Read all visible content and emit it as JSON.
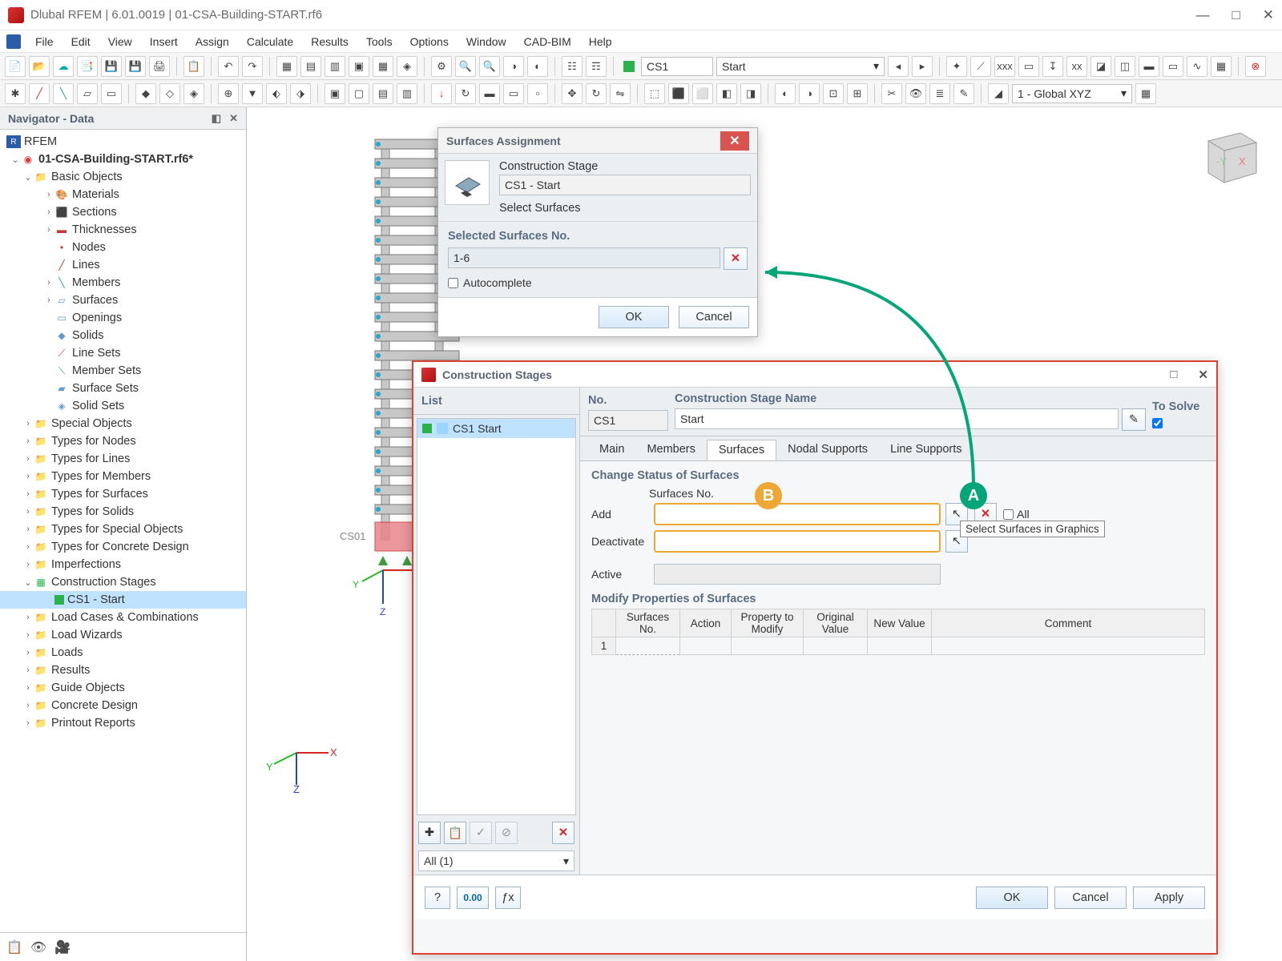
{
  "titlebar": {
    "title": "Dlubal RFEM | 6.01.0019 | 01-CSA-Building-START.rf6"
  },
  "menubar": [
    "File",
    "Edit",
    "View",
    "Insert",
    "Assign",
    "Calculate",
    "Results",
    "Tools",
    "Options",
    "Window",
    "CAD-BIM",
    "Help"
  ],
  "toolbar": {
    "combo_cs": "CS1",
    "combo_stage": "Start",
    "combo_right": "1 - Global XYZ"
  },
  "navigator": {
    "title": "Navigator - Data",
    "root": "RFEM",
    "project": "01-CSA-Building-START.rf6*",
    "basic": "Basic Objects",
    "basic_items": [
      "Materials",
      "Sections",
      "Thicknesses",
      "Nodes",
      "Lines",
      "Members",
      "Surfaces",
      "Openings",
      "Solids",
      "Line Sets",
      "Member Sets",
      "Surface Sets",
      "Solid Sets"
    ],
    "groups": [
      "Special Objects",
      "Types for Nodes",
      "Types for Lines",
      "Types for Members",
      "Types for Surfaces",
      "Types for Solids",
      "Types for Special Objects",
      "Types for Concrete Design",
      "Imperfections"
    ],
    "cs_group": "Construction Stages",
    "cs_child": "CS1 - Start",
    "groups2": [
      "Load Cases & Combinations",
      "Load Wizards",
      "Loads",
      "Results",
      "Guide Objects",
      "Concrete Design",
      "Printout Reports"
    ]
  },
  "canvas": {
    "cs_label": "CS01"
  },
  "surfaces_dialog": {
    "title": "Surfaces Assignment",
    "cs_label": "Construction Stage",
    "cs_value": "CS1 - Start",
    "select_label": "Select Surfaces",
    "selected_label": "Selected Surfaces No.",
    "selected_value": "1-6",
    "autocomplete": "Autocomplete",
    "ok": "OK",
    "cancel": "Cancel"
  },
  "cs_dialog": {
    "title": "Construction Stages",
    "list_label": "List",
    "list_item": "CS1  Start",
    "list_filter": "All (1)",
    "no_label": "No.",
    "no_value": "CS1",
    "name_label": "Construction Stage Name",
    "name_value": "Start",
    "solve_label": "To Solve",
    "tabs": [
      "Main",
      "Members",
      "Surfaces",
      "Nodal Supports",
      "Line Supports"
    ],
    "active_tab": 2,
    "change_status": "Change Status of Surfaces",
    "surfaces_no": "Surfaces No.",
    "add": "Add",
    "deactivate": "Deactivate",
    "active": "Active",
    "all": "All",
    "tooltip": "Select Surfaces in Graphics",
    "modify_label": "Modify Properties of Surfaces",
    "table_headers": [
      "",
      "Surfaces No.",
      "Action",
      "Property to Modify",
      "Original Value",
      "New Value",
      "Comment"
    ],
    "row1": "1",
    "ok": "OK",
    "cancel": "Cancel",
    "apply": "Apply"
  },
  "badges": {
    "a": "A",
    "b": "B"
  }
}
